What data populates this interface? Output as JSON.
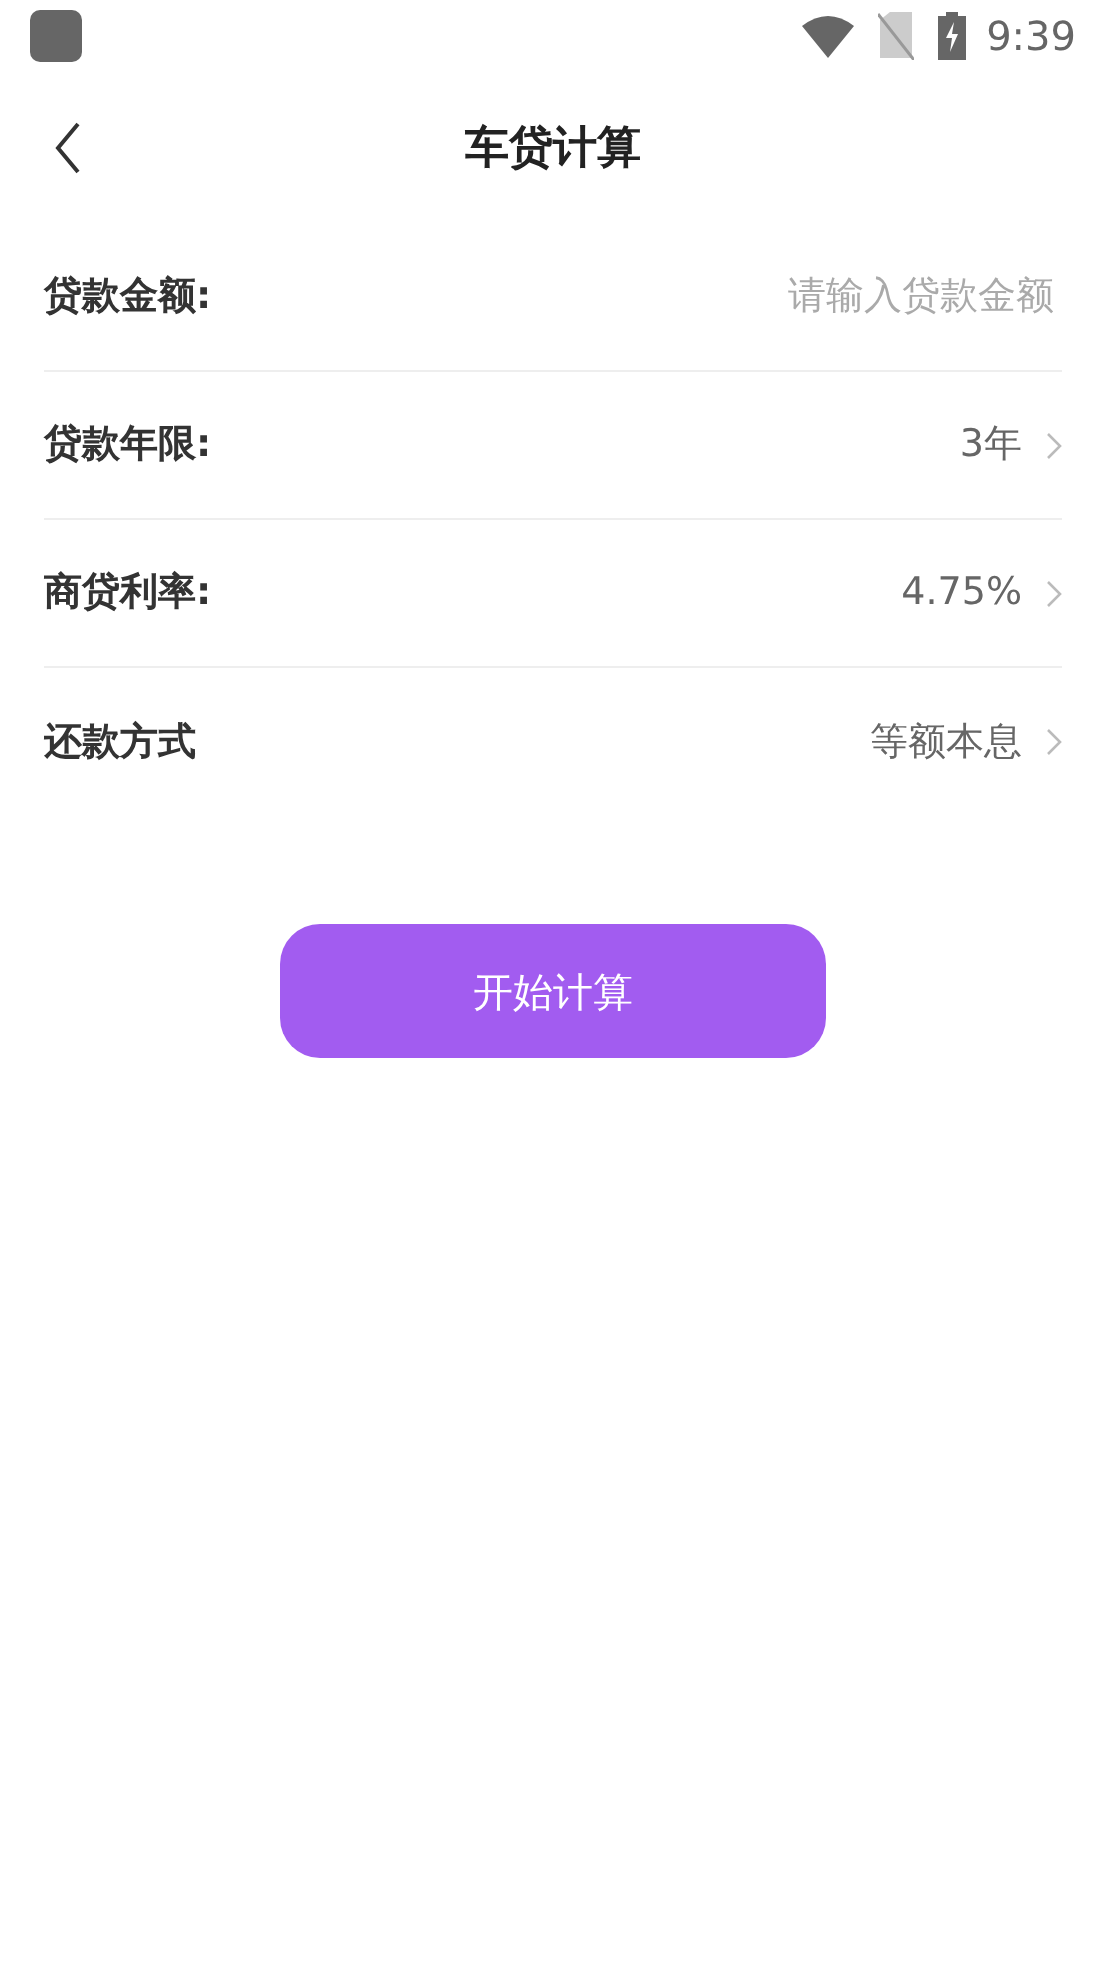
{
  "status_bar": {
    "time": "9:39"
  },
  "header": {
    "title": "车贷计算"
  },
  "fields": [
    {
      "kind": "input",
      "label": "贷款金额:",
      "placeholder": "请输入贷款金额"
    },
    {
      "kind": "select",
      "label": "贷款年限:",
      "value": "3年"
    },
    {
      "kind": "select",
      "label": "商贷利率:",
      "value": "4.75%"
    },
    {
      "kind": "select",
      "label": "还款方式",
      "value": "等额本息"
    }
  ],
  "submit_button": {
    "label": "开始计算"
  }
}
